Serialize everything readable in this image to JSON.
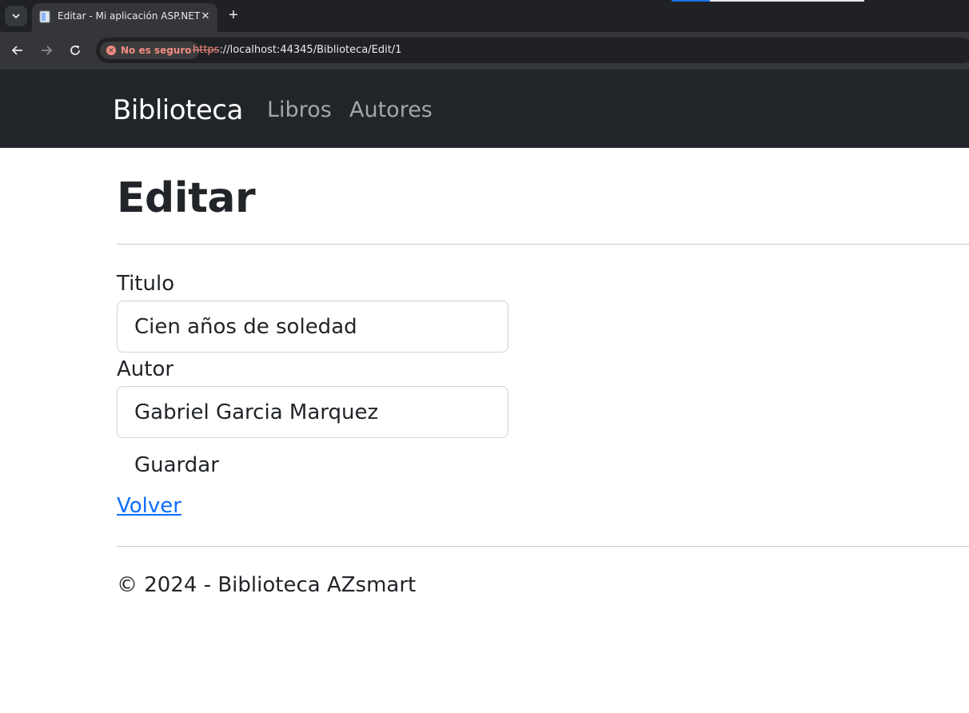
{
  "browser": {
    "tab_title": "Editar - Mi aplicación ASP.NET",
    "security_text": "No es seguro",
    "url_scheme": "https",
    "url_rest": "://localhost:44345/Biblioteca/Edit/1"
  },
  "navbar": {
    "brand": "Biblioteca",
    "links": [
      "Libros",
      "Autores"
    ]
  },
  "page": {
    "title": "Editar"
  },
  "form": {
    "titulo_label": "Titulo",
    "titulo_value": "Cien años de soledad",
    "autor_label": "Autor",
    "autor_value": "Gabriel Garcia Marquez",
    "save_label": "Guardar"
  },
  "back_link": "Volver",
  "footer": "© 2024 - Biblioteca AZsmart",
  "colors": {
    "navbar_bg": "#212529",
    "link": "#0d6efd",
    "insecure": "#f28b82"
  }
}
